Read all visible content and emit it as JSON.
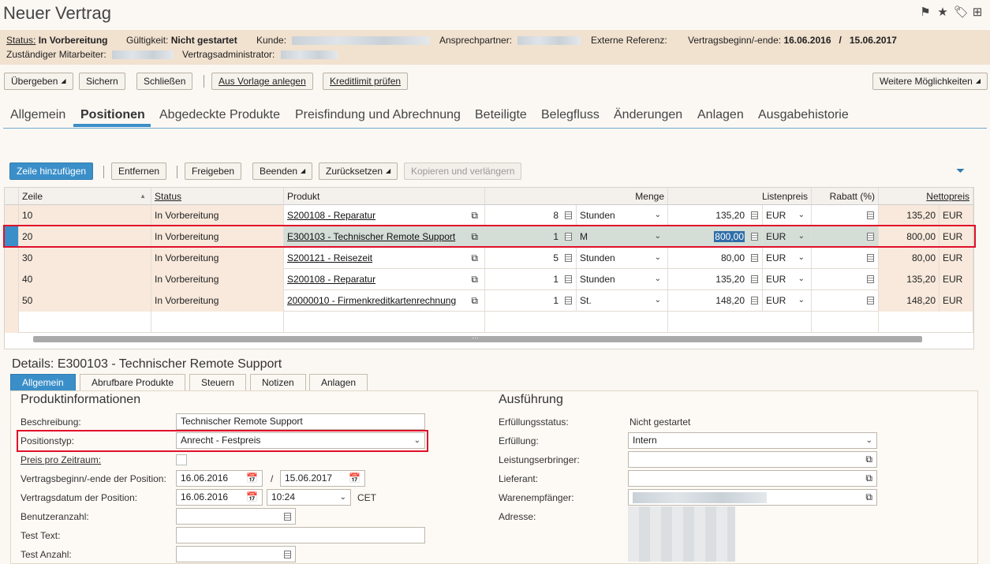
{
  "app": {
    "title": "Neuer Vertrag",
    "icons": [
      "flag-icon",
      "star-icon",
      "tag-icon",
      "add-document-icon"
    ]
  },
  "header": {
    "status_label": "Status:",
    "status_value": "In Vorbereitung",
    "validity_label": "Gültigkeit:",
    "validity_value": "Nicht gestartet",
    "customer_label": "Kunde:",
    "contact_label": "Ansprechpartner:",
    "external_ref_label": "Externe Referenz:",
    "contract_period_label": "Vertragsbeginn/-ende:",
    "contract_start": "16.06.2016",
    "contract_sep": "/",
    "contract_end": "15.06.2017",
    "employee_label": "Zuständiger Mitarbeiter:",
    "admin_label": "Vertragsadministrator:"
  },
  "toolbar": {
    "submit": "Übergeben",
    "save": "Sichern",
    "close": "Schließen",
    "create_from_template": "Aus Vorlage anlegen",
    "check_credit": "Kreditlimit prüfen",
    "more": "Weitere Möglichkeiten"
  },
  "tabs": [
    "Allgemein",
    "Positionen",
    "Abgedeckte Produkte",
    "Preisfindung und Abrechnung",
    "Beteiligte",
    "Belegfluss",
    "Änderungen",
    "Anlagen",
    "Ausgabehistorie"
  ],
  "active_tab": "Positionen",
  "grid_toolbar": {
    "add_row": "Zeile hinzufügen",
    "remove": "Entfernen",
    "release": "Freigeben",
    "end": "Beenden",
    "reset": "Zurücksetzen",
    "copy_extend": "Kopieren und verlängern"
  },
  "grid": {
    "columns": {
      "line": "Zeile",
      "status": "Status",
      "product": "Produkt",
      "quantity": "Menge",
      "list_price": "Listenpreis",
      "discount": "Rabatt (%)",
      "net_price": "Nettopreis"
    },
    "rows": [
      {
        "line": "10",
        "status": "In Vorbereitung",
        "product": "S200108 - Reparatur",
        "qty": "8",
        "unit": "Stunden",
        "price": "135,20",
        "currency": "EUR",
        "net": "135,20",
        "net_currency": "EUR"
      },
      {
        "line": "20",
        "status": "In Vorbereitung",
        "product": "E300103 - Technischer Remote Support",
        "qty": "1",
        "unit": "M",
        "price": "800,00",
        "currency": "EUR",
        "net": "800,00",
        "net_currency": "EUR"
      },
      {
        "line": "30",
        "status": "In Vorbereitung",
        "product": "S200121 - Reisezeit",
        "qty": "5",
        "unit": "Stunden",
        "price": "80,00",
        "currency": "EUR",
        "net": "80,00",
        "net_currency": "EUR"
      },
      {
        "line": "40",
        "status": "In Vorbereitung",
        "product": "S200108 - Reparatur",
        "qty": "1",
        "unit": "Stunden",
        "price": "135,20",
        "currency": "EUR",
        "net": "135,20",
        "net_currency": "EUR"
      },
      {
        "line": "50",
        "status": "In Vorbereitung",
        "product": "20000010 - Firmenkreditkartenrechnung",
        "qty": "1",
        "unit": "St.",
        "price": "148,20",
        "currency": "EUR",
        "net": "148,20",
        "net_currency": "EUR"
      }
    ]
  },
  "details": {
    "label": "Details:",
    "title": "E300103 - Technischer Remote Support",
    "tabs": [
      "Allgemein",
      "Abrufbare Produkte",
      "Steuern",
      "Notizen",
      "Anlagen"
    ],
    "product_info": {
      "heading": "Produktinformationen",
      "description_label": "Beschreibung:",
      "description_value": "Technischer Remote Support",
      "item_type_label": "Positionstyp:",
      "item_type_value": "Anrecht - Festpreis",
      "price_per_period_label": "Preis pro Zeitraum:",
      "period_label": "Vertragsbeginn/-ende der Position:",
      "period_start": "16.06.2016",
      "period_sep": "/",
      "period_end": "15.06.2017",
      "contract_date_label": "Vertragsdatum der Position:",
      "contract_date": "16.06.2016",
      "contract_time": "10:24",
      "timezone": "CET",
      "user_count_label": "Benutzeranzahl:",
      "test_text_label": "Test Text:",
      "test_count_label": "Test Anzahl:"
    },
    "execution": {
      "heading": "Ausführung",
      "fulfillment_status_label": "Erfüllungsstatus:",
      "fulfillment_status_value": "Nicht gestartet",
      "fulfillment_label": "Erfüllung:",
      "fulfillment_value": "Intern",
      "service_provider_label": "Leistungserbringer:",
      "supplier_label": "Lieferant:",
      "recipient_label": "Warenempfänger:",
      "address_label": "Adresse:"
    }
  }
}
